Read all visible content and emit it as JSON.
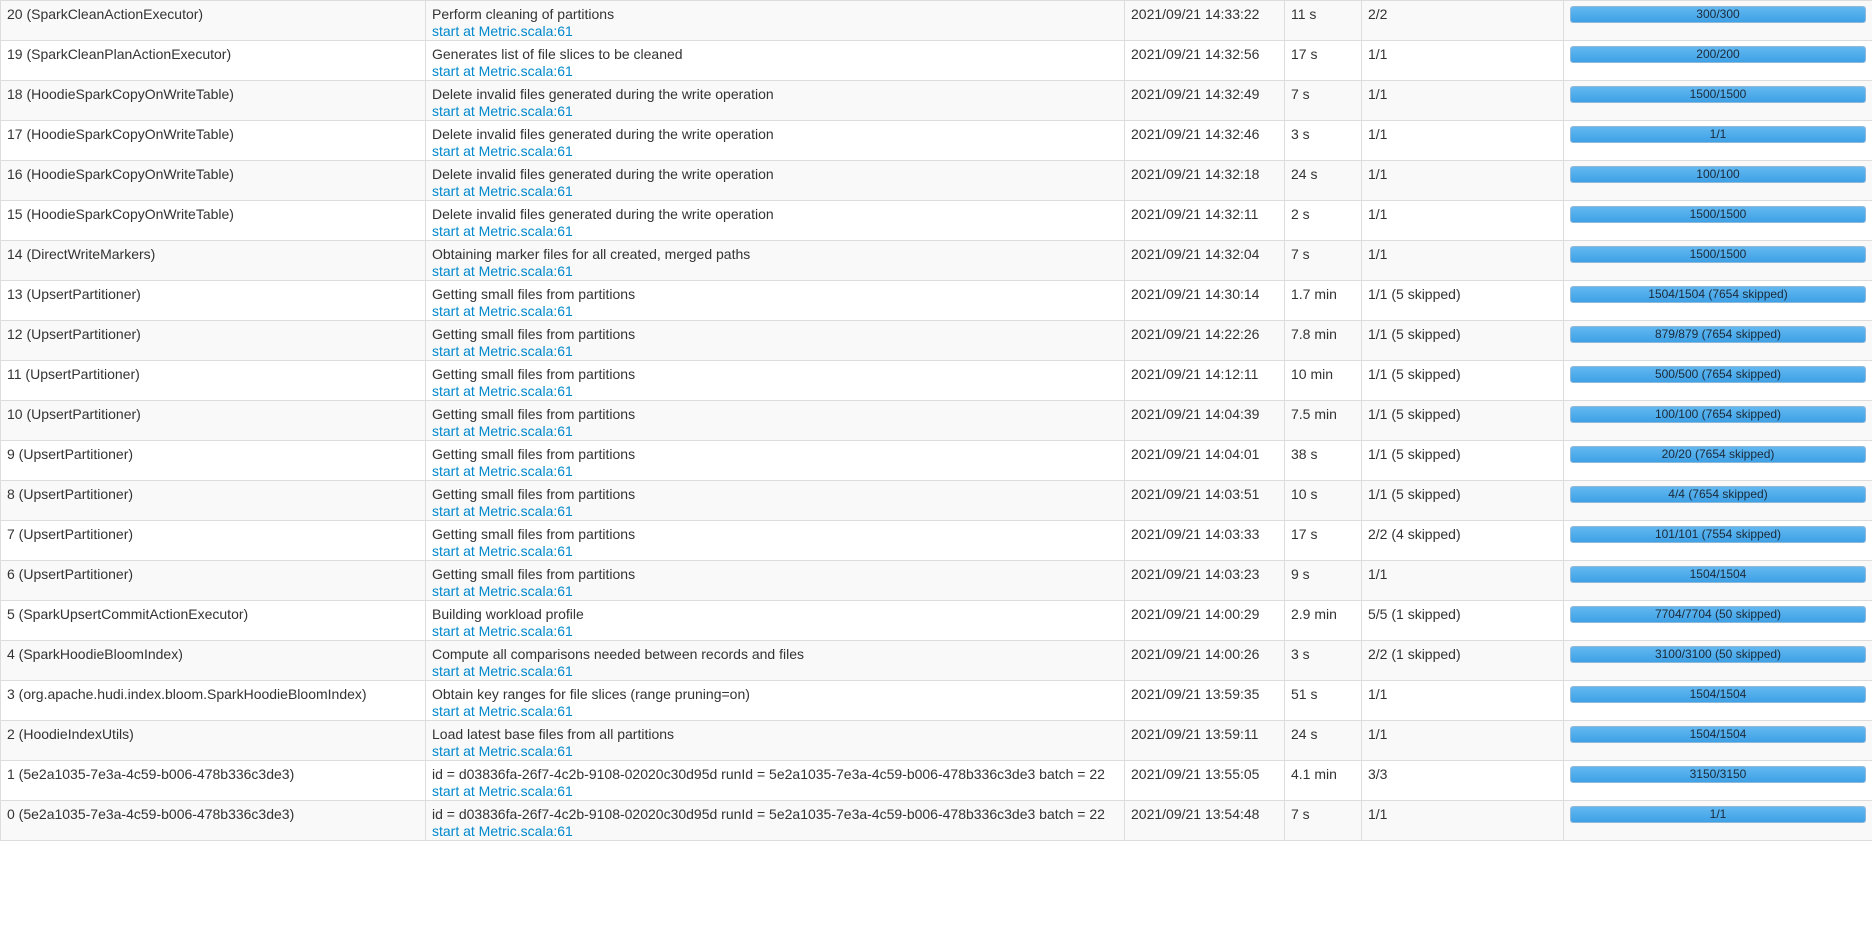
{
  "jobs": [
    {
      "job": "20 (SparkCleanActionExecutor)",
      "description": "Perform cleaning of partitions",
      "link": "start at Metric.scala:61",
      "submitted": "2021/09/21 14:33:22",
      "duration": "11 s",
      "stages": "2/2",
      "tasks": "300/300",
      "progress": 1.0
    },
    {
      "job": "19 (SparkCleanPlanActionExecutor)",
      "description": "Generates list of file slices to be cleaned",
      "link": "start at Metric.scala:61",
      "submitted": "2021/09/21 14:32:56",
      "duration": "17 s",
      "stages": "1/1",
      "tasks": "200/200",
      "progress": 1.0
    },
    {
      "job": "18 (HoodieSparkCopyOnWriteTable)",
      "description": "Delete invalid files generated during the write operation",
      "link": "start at Metric.scala:61",
      "submitted": "2021/09/21 14:32:49",
      "duration": "7 s",
      "stages": "1/1",
      "tasks": "1500/1500",
      "progress": 1.0
    },
    {
      "job": "17 (HoodieSparkCopyOnWriteTable)",
      "description": "Delete invalid files generated during the write operation",
      "link": "start at Metric.scala:61",
      "submitted": "2021/09/21 14:32:46",
      "duration": "3 s",
      "stages": "1/1",
      "tasks": "1/1",
      "progress": 1.0
    },
    {
      "job": "16 (HoodieSparkCopyOnWriteTable)",
      "description": "Delete invalid files generated during the write operation",
      "link": "start at Metric.scala:61",
      "submitted": "2021/09/21 14:32:18",
      "duration": "24 s",
      "stages": "1/1",
      "tasks": "100/100",
      "progress": 1.0
    },
    {
      "job": "15 (HoodieSparkCopyOnWriteTable)",
      "description": "Delete invalid files generated during the write operation",
      "link": "start at Metric.scala:61",
      "submitted": "2021/09/21 14:32:11",
      "duration": "2 s",
      "stages": "1/1",
      "tasks": "1500/1500",
      "progress": 1.0
    },
    {
      "job": "14 (DirectWriteMarkers)",
      "description": "Obtaining marker files for all created, merged paths",
      "link": "start at Metric.scala:61",
      "submitted": "2021/09/21 14:32:04",
      "duration": "7 s",
      "stages": "1/1",
      "tasks": "1500/1500",
      "progress": 1.0
    },
    {
      "job": "13 (UpsertPartitioner)",
      "description": "Getting small files from partitions",
      "link": "start at Metric.scala:61",
      "submitted": "2021/09/21 14:30:14",
      "duration": "1.7 min",
      "stages": "1/1 (5 skipped)",
      "tasks": "1504/1504 (7654 skipped)",
      "progress": 1.0
    },
    {
      "job": "12 (UpsertPartitioner)",
      "description": "Getting small files from partitions",
      "link": "start at Metric.scala:61",
      "submitted": "2021/09/21 14:22:26",
      "duration": "7.8 min",
      "stages": "1/1 (5 skipped)",
      "tasks": "879/879 (7654 skipped)",
      "progress": 1.0
    },
    {
      "job": "11 (UpsertPartitioner)",
      "description": "Getting small files from partitions",
      "link": "start at Metric.scala:61",
      "submitted": "2021/09/21 14:12:11",
      "duration": "10 min",
      "stages": "1/1 (5 skipped)",
      "tasks": "500/500 (7654 skipped)",
      "progress": 1.0
    },
    {
      "job": "10 (UpsertPartitioner)",
      "description": "Getting small files from partitions",
      "link": "start at Metric.scala:61",
      "submitted": "2021/09/21 14:04:39",
      "duration": "7.5 min",
      "stages": "1/1 (5 skipped)",
      "tasks": "100/100 (7654 skipped)",
      "progress": 1.0
    },
    {
      "job": "9 (UpsertPartitioner)",
      "description": "Getting small files from partitions",
      "link": "start at Metric.scala:61",
      "submitted": "2021/09/21 14:04:01",
      "duration": "38 s",
      "stages": "1/1 (5 skipped)",
      "tasks": "20/20 (7654 skipped)",
      "progress": 1.0
    },
    {
      "job": "8 (UpsertPartitioner)",
      "description": "Getting small files from partitions",
      "link": "start at Metric.scala:61",
      "submitted": "2021/09/21 14:03:51",
      "duration": "10 s",
      "stages": "1/1 (5 skipped)",
      "tasks": "4/4 (7654 skipped)",
      "progress": 1.0
    },
    {
      "job": "7 (UpsertPartitioner)",
      "description": "Getting small files from partitions",
      "link": "start at Metric.scala:61",
      "submitted": "2021/09/21 14:03:33",
      "duration": "17 s",
      "stages": "2/2 (4 skipped)",
      "tasks": "101/101 (7554 skipped)",
      "progress": 1.0
    },
    {
      "job": "6 (UpsertPartitioner)",
      "description": "Getting small files from partitions",
      "link": "start at Metric.scala:61",
      "submitted": "2021/09/21 14:03:23",
      "duration": "9 s",
      "stages": "1/1",
      "tasks": "1504/1504",
      "progress": 1.0
    },
    {
      "job": "5 (SparkUpsertCommitActionExecutor)",
      "description": "Building workload profile",
      "link": "start at Metric.scala:61",
      "submitted": "2021/09/21 14:00:29",
      "duration": "2.9 min",
      "stages": "5/5 (1 skipped)",
      "tasks": "7704/7704 (50 skipped)",
      "progress": 1.0
    },
    {
      "job": "4 (SparkHoodieBloomIndex)",
      "description": "Compute all comparisons needed between records and files",
      "link": "start at Metric.scala:61",
      "submitted": "2021/09/21 14:00:26",
      "duration": "3 s",
      "stages": "2/2 (1 skipped)",
      "tasks": "3100/3100 (50 skipped)",
      "progress": 1.0
    },
    {
      "job": "3 (org.apache.hudi.index.bloom.SparkHoodieBloomIndex)",
      "description": "Obtain key ranges for file slices (range pruning=on)",
      "link": "start at Metric.scala:61",
      "submitted": "2021/09/21 13:59:35",
      "duration": "51 s",
      "stages": "1/1",
      "tasks": "1504/1504",
      "progress": 1.0
    },
    {
      "job": "2 (HoodieIndexUtils)",
      "description": "Load latest base files from all partitions",
      "link": "start at Metric.scala:61",
      "submitted": "2021/09/21 13:59:11",
      "duration": "24 s",
      "stages": "1/1",
      "tasks": "1504/1504",
      "progress": 1.0
    },
    {
      "job": "1 (5e2a1035-7e3a-4c59-b006-478b336c3de3)",
      "description": "id = d03836fa-26f7-4c2b-9108-02020c30d95d runId = 5e2a1035-7e3a-4c59-b006-478b336c3de3 batch = 22",
      "link": "start at Metric.scala:61",
      "submitted": "2021/09/21 13:55:05",
      "duration": "4.1 min",
      "stages": "3/3",
      "tasks": "3150/3150",
      "progress": 1.0
    },
    {
      "job": "0 (5e2a1035-7e3a-4c59-b006-478b336c3de3)",
      "description": "id = d03836fa-26f7-4c2b-9108-02020c30d95d runId = 5e2a1035-7e3a-4c59-b006-478b336c3de3 batch = 22",
      "link": "start at Metric.scala:61",
      "submitted": "2021/09/21 13:54:48",
      "duration": "7 s",
      "stages": "1/1",
      "tasks": "1/1",
      "progress": 1.0
    }
  ]
}
